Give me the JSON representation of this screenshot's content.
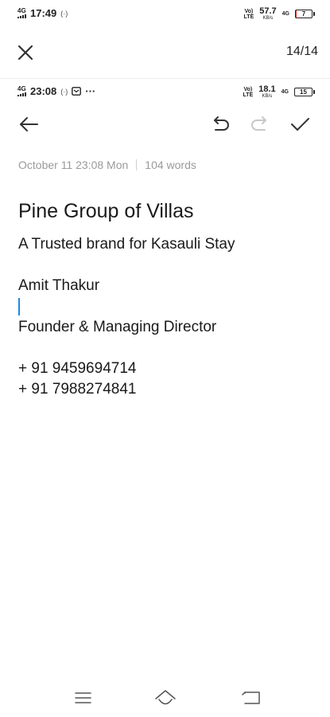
{
  "status_outer": {
    "network": "4G",
    "time": "17:49",
    "volte": "Vo)",
    "lte": "LTE",
    "speed_value": "57.7",
    "speed_unit": "KB/s",
    "network_right": "4G",
    "battery_level": "7"
  },
  "viewer": {
    "page_indicator": "14/14"
  },
  "status_inner": {
    "network": "4G",
    "time": "23:08",
    "more": "···",
    "volte": "Vo)",
    "lte": "LTE",
    "speed_value": "18.1",
    "speed_unit": "KB/s",
    "network_right": "4G",
    "battery_level": "15"
  },
  "note": {
    "date": "October 11 23:08 Mon",
    "word_count": "104 words",
    "title": "Pine Group of Villas",
    "lines": [
      "A Trusted brand for Kasauli Stay",
      "",
      "Amit Thakur",
      "",
      "Founder & Managing Director",
      "",
      "+ 91 9459694714",
      "+ 91 7988274841"
    ]
  },
  "colors": {
    "caret": "#1e88e5",
    "battery_low": "#e0312f",
    "meta_text": "#9a9a9a"
  }
}
